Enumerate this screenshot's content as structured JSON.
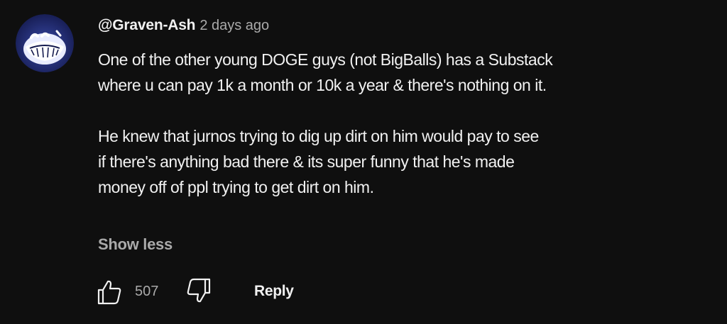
{
  "comment": {
    "author": "@Graven-Ash",
    "timestamp": "2 days ago",
    "paragraphs": [
      [
        "One of the other young DOGE guys (not BigBalls) has a Substack",
        "where u can pay 1k a month or 10k a year & there's nothing on it."
      ],
      [
        "He knew that jurnos trying to dig up dirt on him would pay to see",
        "if there's anything bad there & its super funny that he's made",
        "money off of ppl trying to get dirt on him."
      ]
    ],
    "toggle_label": "Show less",
    "likes": "507",
    "reply_label": "Reply",
    "avatar_icon": "grinning-ghost-avatar",
    "like_icon": "thumbs-up-icon",
    "dislike_icon": "thumbs-down-icon"
  },
  "colors": {
    "background": "#0f0f0f",
    "primary_text": "#f1f1f1",
    "secondary_text": "#aaaaaa",
    "avatar_bg": "#1e2868"
  }
}
